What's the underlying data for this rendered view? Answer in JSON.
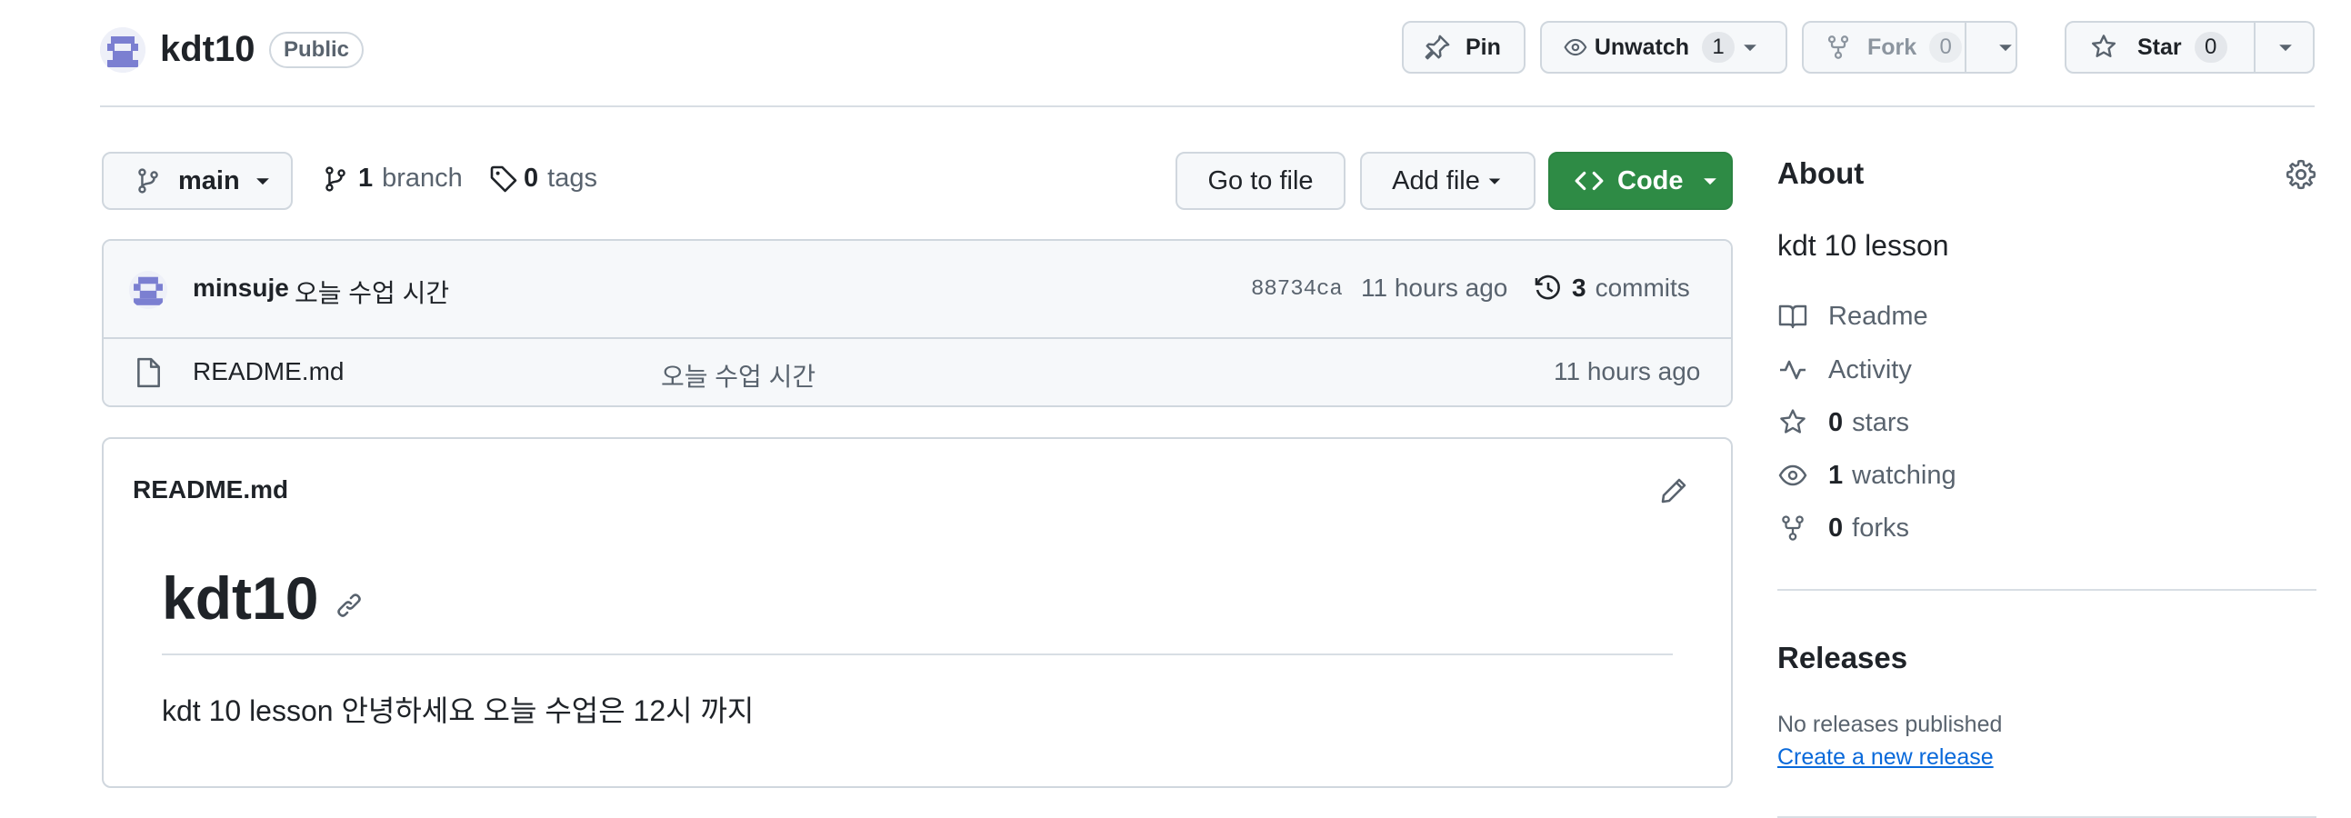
{
  "repo": {
    "name": "kdt10",
    "visibility": "Public"
  },
  "header_actions": {
    "pin_label": "Pin",
    "unwatch_label": "Unwatch",
    "unwatch_count": "1",
    "fork_label": "Fork",
    "fork_count": "0",
    "star_label": "Star",
    "star_count": "0"
  },
  "repo_bar": {
    "branch_name": "main",
    "branch_count": "1",
    "branch_label": "branch",
    "tag_count": "0",
    "tag_label": "tags",
    "go_to_file": "Go to file",
    "add_file": "Add file",
    "code": "Code"
  },
  "latest_commit": {
    "author": "minsuje",
    "message": "오늘 수업 시간",
    "sha": "88734ca",
    "time": "11 hours ago",
    "commit_count": "3",
    "commit_label": "commits"
  },
  "files": [
    {
      "name": "README.md",
      "message": "오늘 수업 시간",
      "time": "11 hours ago"
    }
  ],
  "readme": {
    "filename": "README.md",
    "heading": "kdt10",
    "body": "kdt 10 lesson 안녕하세요 오늘 수업은 12시 까지"
  },
  "about": {
    "title": "About",
    "description": "kdt 10 lesson",
    "readme_label": "Readme",
    "activity_label": "Activity",
    "stars_count": "0",
    "stars_label": "stars",
    "watching_count": "1",
    "watching_label": "watching",
    "forks_count": "0",
    "forks_label": "forks"
  },
  "releases": {
    "title": "Releases",
    "none_text": "No releases published",
    "create_link": "Create a new release"
  },
  "colors": {
    "code_button": "#2e8b45",
    "link": "#0969da",
    "border": "#d0d7de",
    "muted_text": "#59636e"
  },
  "icons": [
    "repo-avatar",
    "pin-icon",
    "eye-icon",
    "fork-icon",
    "star-icon",
    "branch-icon",
    "tag-icon",
    "code-icon",
    "history-icon",
    "file-icon",
    "pencil-icon",
    "link-icon",
    "gear-icon",
    "book-icon",
    "pulse-icon",
    "caret-down-icon"
  ]
}
